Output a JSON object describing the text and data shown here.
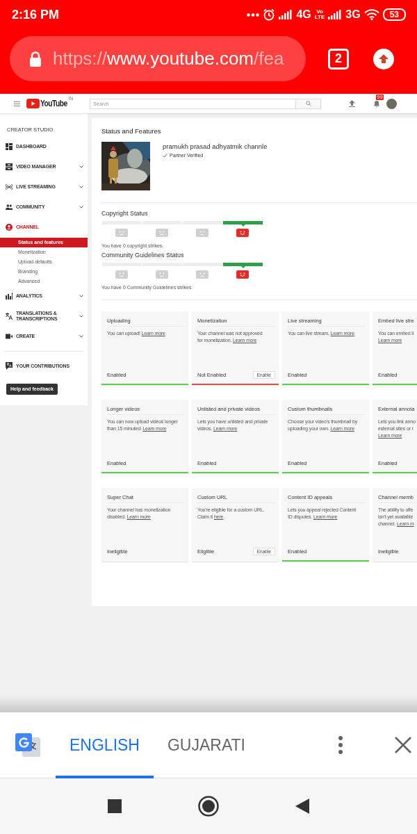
{
  "status_bar": {
    "time": "2:16 PM",
    "network_1": "4G",
    "volte_top": "Vo",
    "volte_bottom": "LTE",
    "network_2": "3G",
    "battery": "53"
  },
  "browser": {
    "url": [
      {
        "text": "https://",
        "dim": true
      },
      {
        "text": "www.youtube.com",
        "dim": false
      },
      {
        "text": "/fea",
        "dim": true
      }
    ],
    "tab_count": "2"
  },
  "header": {
    "logo": "YouTube",
    "region": "IN",
    "search": {
      "placeholder": "Search"
    },
    "notification_badge": "99"
  },
  "sidebar": {
    "heading": "CREATOR STUDIO",
    "items": [
      {
        "label": "DASHBOARD",
        "expandable": false,
        "selected": false
      },
      {
        "label": "VIDEO MANAGER",
        "expandable": true,
        "selected": false
      },
      {
        "label": "LIVE STREAMING",
        "expandable": true,
        "selected": false
      },
      {
        "label": "COMMUNITY",
        "expandable": true,
        "selected": false
      },
      {
        "label": "CHANNEL",
        "expandable": false,
        "selected": true,
        "children": [
          {
            "label": "Status and features",
            "selected": true
          },
          {
            "label": "Monetization",
            "selected": false
          },
          {
            "label": "Upload defaults",
            "selected": false
          },
          {
            "label": "Branding",
            "selected": false
          },
          {
            "label": "Advanced",
            "selected": false
          }
        ]
      },
      {
        "label": "ANALYTICS",
        "expandable": true,
        "selected": false
      },
      {
        "label": "TRANSLATIONS & TRANSCRIPTIONS",
        "expandable": true,
        "selected": false
      },
      {
        "label": "CREATE",
        "expandable": true,
        "selected": false
      }
    ],
    "contributions": "YOUR CONTRIBUTIONS",
    "help_button": "Help and feedback"
  },
  "main": {
    "title": "Status and Features",
    "channel": {
      "name": "pramukh prasad adhyatmik channle",
      "badge": "Partner Verified"
    },
    "statuses": [
      {
        "title": "Copyright Status",
        "levels": [
          {
            "selected": false
          },
          {
            "selected": false
          },
          {
            "selected": false
          },
          {
            "selected": true
          }
        ],
        "message": "You have 0 copyright strikes."
      },
      {
        "title": "Community Guidelines Status",
        "levels": [
          {
            "selected": false
          },
          {
            "selected": false
          },
          {
            "selected": false
          },
          {
            "selected": true
          }
        ],
        "message": "You have 0 Community Guidelines strikes."
      }
    ],
    "features": [
      {
        "title": "Uploading",
        "lines": [
          [
            {
              "text": "You can upload! "
            },
            {
              "text": "Learn more",
              "link": true
            }
          ]
        ],
        "status": "Enabled",
        "kind": "enabled"
      },
      {
        "title": "Monetization",
        "lines": [
          [
            {
              "text": "Your channel was not approved"
            }
          ],
          [
            {
              "text": "for monetization. "
            },
            {
              "text": "Learn more",
              "link": true
            }
          ]
        ],
        "status": "Not Enabled",
        "kind": "disabled",
        "button": "Enable"
      },
      {
        "title": "Live streaming",
        "lines": [
          [
            {
              "text": "You can live stream. "
            },
            {
              "text": "Learn more",
              "link": true
            }
          ]
        ],
        "status": "Enabled",
        "kind": "enabled"
      },
      {
        "title": "Embed live stre",
        "lines": [
          [
            {
              "text": "You can embed li"
            }
          ],
          [
            {
              "text": "Learn more",
              "link": true
            }
          ]
        ],
        "status": "Enabled",
        "kind": "enabled"
      },
      {
        "title": "Longer videos",
        "lines": [
          [
            {
              "text": "You can now upload videos longer"
            }
          ],
          [
            {
              "text": "than 15 minutes! "
            },
            {
              "text": "Learn more",
              "link": true
            }
          ]
        ],
        "status": "Enabled",
        "kind": "enabled"
      },
      {
        "title": "Unlisted and private videos",
        "lines": [
          [
            {
              "text": "Lets you have unlisted and private"
            }
          ],
          [
            {
              "text": "videos. "
            },
            {
              "text": "Learn more",
              "link": true
            }
          ]
        ],
        "status": "Enabled",
        "kind": "enabled"
      },
      {
        "title": "Custom thumbnails",
        "lines": [
          [
            {
              "text": "Choose your video's thumbnail by"
            }
          ],
          [
            {
              "text": "uploading your own. "
            },
            {
              "text": "Learn more",
              "link": true
            }
          ]
        ],
        "status": "Enabled",
        "kind": "enabled"
      },
      {
        "title": "External annota",
        "lines": [
          [
            {
              "text": "Lets you link anno"
            }
          ],
          [
            {
              "text": "external sites or r"
            }
          ],
          [
            {
              "text": "Learn more",
              "link": true
            }
          ]
        ],
        "status": "Enabled",
        "kind": "enabled"
      },
      {
        "title": "Super Chat",
        "lines": [
          [
            {
              "text": "Your channel has monetization"
            }
          ],
          [
            {
              "text": "disabled. "
            },
            {
              "text": "Learn more",
              "link": true
            }
          ]
        ],
        "status": "Ineligible",
        "kind": "neutral"
      },
      {
        "title": "Custom URL",
        "lines": [
          [
            {
              "text": "You're eligible for a custom URL."
            }
          ],
          [
            {
              "text": "Claim it "
            },
            {
              "text": "here",
              "link": true
            },
            {
              "text": "."
            }
          ]
        ],
        "status": "Eligible",
        "kind": "neutral",
        "button": "Enable"
      },
      {
        "title": "Content ID appeals",
        "lines": [
          [
            {
              "text": "Lets you appeal rejected Content"
            }
          ],
          [
            {
              "text": "ID disputes. "
            },
            {
              "text": "Learn more",
              "link": true
            }
          ]
        ],
        "status": "Enabled",
        "kind": "enabled"
      },
      {
        "title": "Channel memb",
        "lines": [
          [
            {
              "text": "The ability to offe"
            }
          ],
          [
            {
              "text": "isn't yet available"
            }
          ],
          [
            {
              "text": "channel. "
            },
            {
              "text": "Learn m",
              "link": true
            }
          ]
        ],
        "status": "Ineligible",
        "kind": "neutral"
      }
    ]
  },
  "translate_bar": {
    "tabs": [
      {
        "label": "ENGLISH",
        "selected": true
      },
      {
        "label": "GUJARATI",
        "selected": false
      }
    ]
  }
}
